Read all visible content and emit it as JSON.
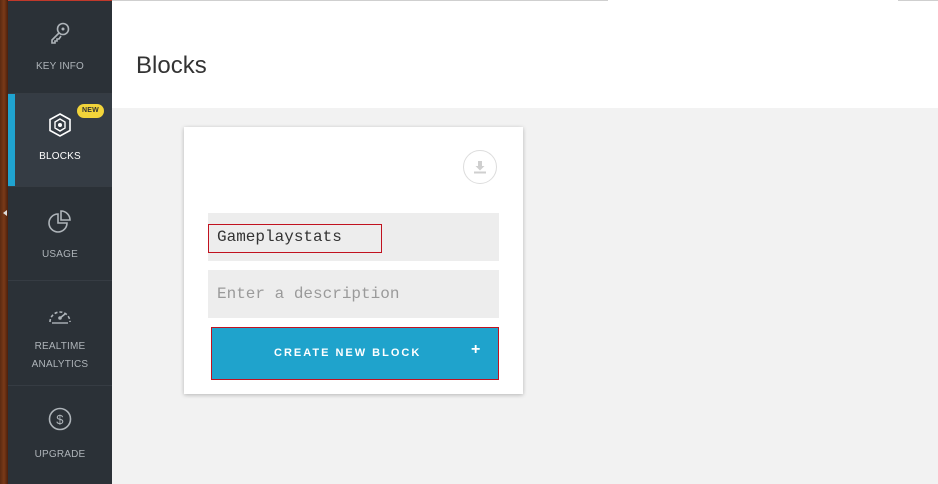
{
  "sidebar": {
    "items": [
      {
        "label": "KEY INFO",
        "icon": "key-icon"
      },
      {
        "label": "BLOCKS",
        "icon": "blocks-icon",
        "badge": "NEW",
        "active": true
      },
      {
        "label": "USAGE",
        "icon": "pie-chart-icon"
      },
      {
        "label": "REALTIME ANALYTICS",
        "label_line1": "REALTIME",
        "label_line2": "ANALYTICS",
        "icon": "speedometer-icon"
      },
      {
        "label": "UPGRADE",
        "icon": "dollar-icon"
      }
    ]
  },
  "header": {
    "title": "Blocks"
  },
  "card": {
    "download_icon": "download-icon",
    "name_value": "Gameplaystats",
    "description_placeholder": "Enter a description",
    "create_label": "CREATE NEW BLOCK",
    "create_icon": "+"
  },
  "colors": {
    "sidebar_bg": "#2b3137",
    "accent": "#1fa3cc",
    "badge": "#f2d43a",
    "highlight": "#c1121f"
  }
}
